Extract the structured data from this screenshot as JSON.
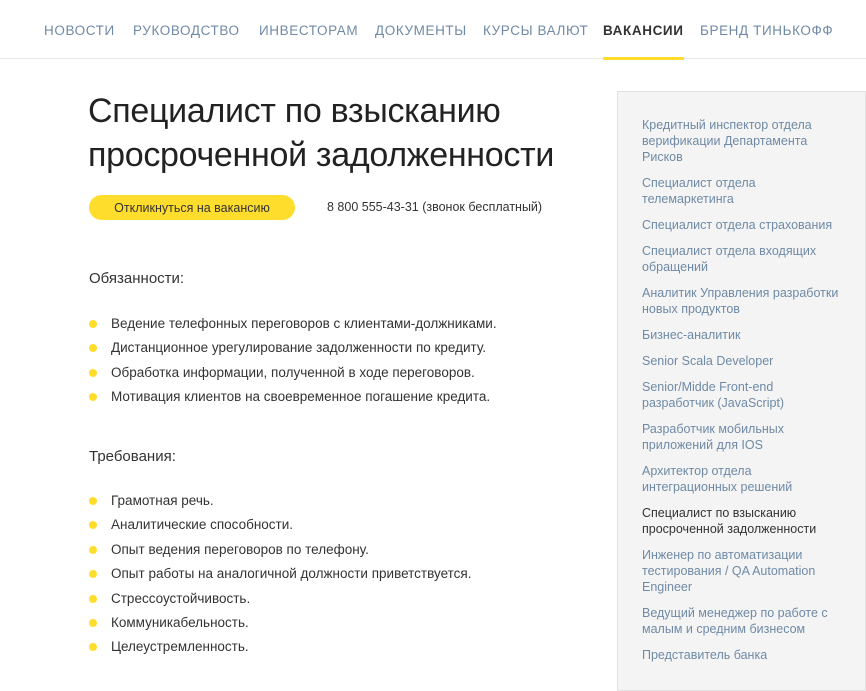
{
  "nav": {
    "items": [
      {
        "label": "НОВОСТИ"
      },
      {
        "label": "РУКОВОДСТВО"
      },
      {
        "label": "ИНВЕСТОРАМ"
      },
      {
        "label": "ДОКУМЕНТЫ"
      },
      {
        "label": "КУРСЫ ВАЛЮТ"
      },
      {
        "label": "ВАКАНСИИ",
        "active": true
      },
      {
        "label": "БРЕНД ТИНЬКОФФ"
      }
    ]
  },
  "vacancy": {
    "title": "Специалист по взысканию просроченной задолженности",
    "apply_label": "Откликнуться на вакансию",
    "phone": "8 800 555-43-31 (звонок бесплатный)",
    "duties_title": "Обязанности:",
    "duties": [
      "Ведение телефонных переговоров с клиентами-должниками.",
      "Дистанционное урегулирование задолженности по кредиту.",
      "Обработка информации, полученной в ходе переговоров.",
      "Мотивация клиентов на своевременное погашение кредита."
    ],
    "requirements_title": "Требования:",
    "requirements": [
      "Грамотная речь.",
      "Аналитические способности.",
      "Опыт ведения переговоров по телефону.",
      "Опыт работы на аналогичной должности приветствуется.",
      "Стрессоустойчивость.",
      "Коммуникабельность.",
      "Целеустремленность."
    ]
  },
  "sidebar": {
    "items": [
      {
        "label": "Кредитный инспектор отдела верификации Департамента Рисков"
      },
      {
        "label": "Специалист отдела телемаркетинга"
      },
      {
        "label": "Специалист отдела страхования"
      },
      {
        "label": "Специалист отдела входящих обращений"
      },
      {
        "label": "Аналитик Управления разработки новых продуктов"
      },
      {
        "label": "Бизнес-аналитик"
      },
      {
        "label": "Senior Scala Developer"
      },
      {
        "label": "Senior/Midde Front-end разработчик (JavaScript)"
      },
      {
        "label": "Разработчик мобильных приложений для IOS"
      },
      {
        "label": "Архитектор отдела интеграционных решений"
      },
      {
        "label": "Специалист по взысканию просроченной задолженности",
        "current": true
      },
      {
        "label": "Инженер по автоматизации тестирования / QA Automation Engineer"
      },
      {
        "label": "Ведущий менеджер по работе с малым и средним бизнесом"
      },
      {
        "label": "Представитель банка"
      }
    ]
  },
  "colors": {
    "accent": "#ffdd2d",
    "link": "#6f8aa6",
    "text": "#333333",
    "sidebar_bg": "#f4f4f4"
  }
}
